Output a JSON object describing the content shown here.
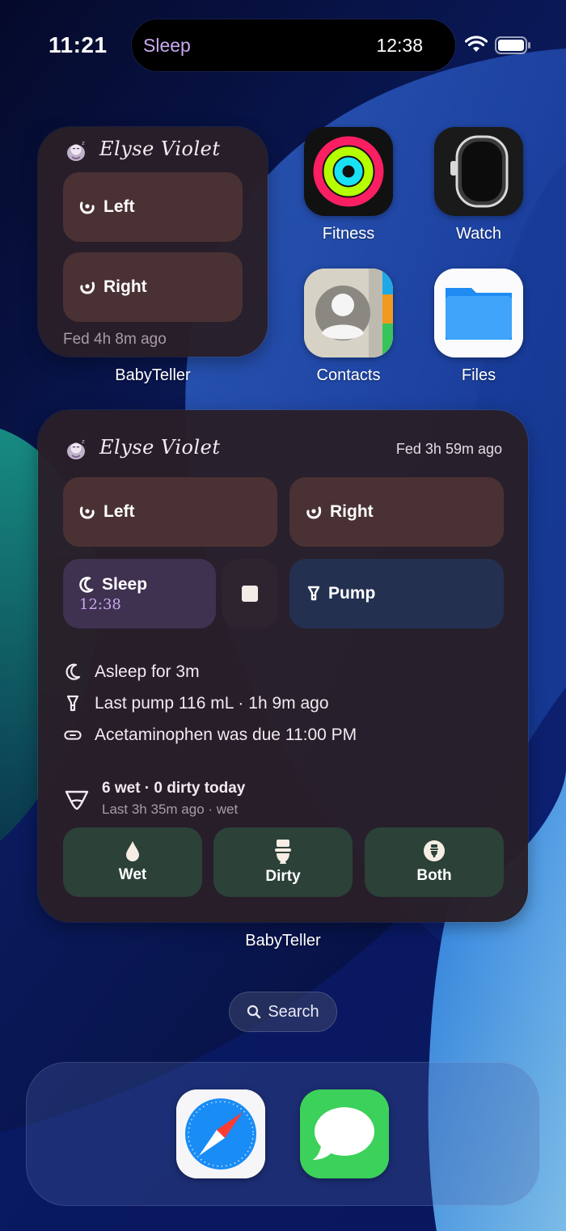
{
  "status_bar": {
    "time": "11:21",
    "island_activity": "Sleep",
    "island_timer": "12:38"
  },
  "small_widget": {
    "baby_name": "Elyse Violet",
    "left_label": "Left",
    "right_label": "Right",
    "fed_status": "Fed 4h 8m ago",
    "app_label": "BabyTeller"
  },
  "apps": {
    "fitness": "Fitness",
    "watch": "Watch",
    "contacts": "Contacts",
    "files": "Files"
  },
  "large_widget": {
    "baby_name": "Elyse Violet",
    "fed_status": "Fed 3h 59m ago",
    "left_label": "Left",
    "right_label": "Right",
    "sleep_label": "Sleep",
    "sleep_timer": "12:38",
    "pump_label": "Pump",
    "asleep_text": "Asleep for 3m",
    "pump_text": "Last pump 116 mL · 1h 9m ago",
    "medicine_text": "Acetaminophen was due 11:00 PM",
    "diaper_summary": "6 wet · 0 dirty today",
    "diaper_last": "Last 3h 35m ago · wet",
    "wet_label": "Wet",
    "dirty_label": "Dirty",
    "both_label": "Both",
    "app_label": "BabyTeller"
  },
  "search": {
    "label": "Search"
  },
  "colors": {
    "widget_bg": "#281f28",
    "feed_button": "#4a3134",
    "sleep_button": "#3f3150",
    "pump_button": "#243050",
    "diaper_button": "#2c4138",
    "island_accent": "#c9a9f0"
  },
  "icons": [
    "wifi-icon",
    "battery-icon",
    "baby-icon",
    "breast-left-icon",
    "breast-right-icon",
    "moon-icon",
    "stop-icon",
    "pump-icon",
    "pill-icon",
    "diaper-icon",
    "drop-icon",
    "toilet-icon",
    "both-icon",
    "search-icon",
    "safari-icon",
    "messages-icon",
    "fitness-icon",
    "watch-icon",
    "contacts-icon",
    "files-icon"
  ]
}
